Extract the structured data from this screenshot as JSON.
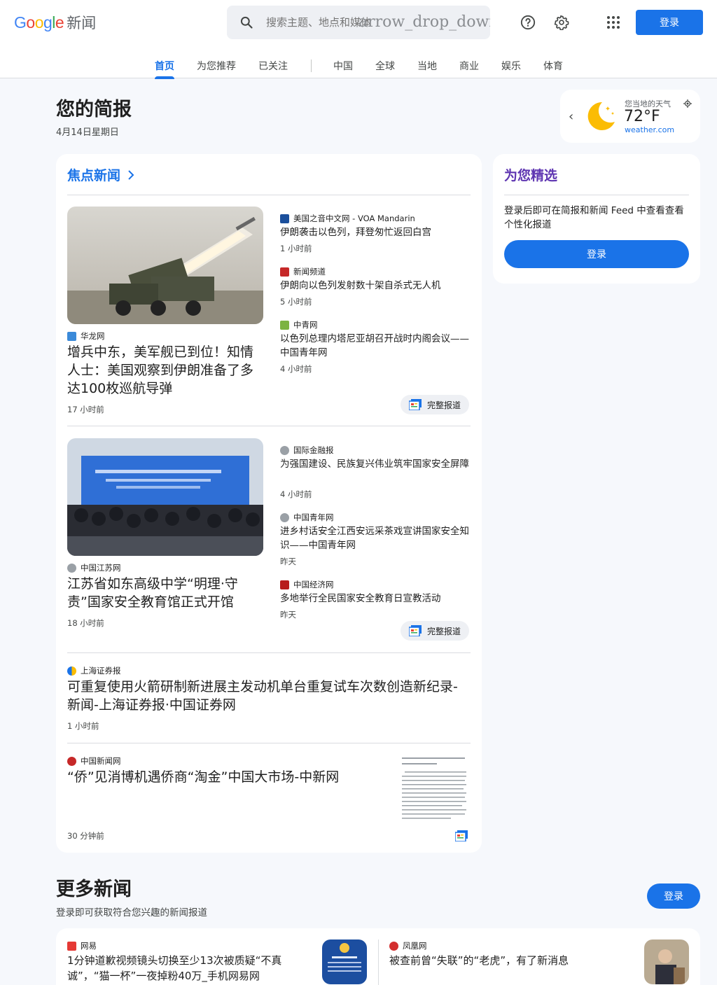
{
  "header": {
    "logo_word": "Google",
    "logo_news": "新闻",
    "search_placeholder": "搜索主题、地点和媒体",
    "search_ligature": "arrow_drop_down",
    "login_label": "登录",
    "icons": [
      "search-icon",
      "help-icon",
      "gear-icon",
      "apps-icon"
    ]
  },
  "nav": {
    "tabs": [
      {
        "label": "首页",
        "active": true
      },
      {
        "label": "为您推荐"
      },
      {
        "label": "已关注"
      },
      {
        "label": "中国"
      },
      {
        "label": "全球"
      },
      {
        "label": "当地"
      },
      {
        "label": "商业"
      },
      {
        "label": "娱乐"
      },
      {
        "label": "体育"
      }
    ]
  },
  "briefing": {
    "title": "您的简报",
    "date": "4月14日星期日"
  },
  "weather": {
    "label": "您当地的天气",
    "temp": "72°F",
    "source": "weather.com"
  },
  "focus": {
    "title": "焦点新闻",
    "full_coverage": "完整报道",
    "cluster1": {
      "main": {
        "source": "华龙网",
        "headline": "增兵中东，美军舰已到位！知情人士：美国观察到伊朗准备了多达100枚巡航导弹",
        "time": "17 小时前"
      },
      "side": [
        {
          "source": "美国之音中文网 - VOA Mandarin",
          "headline": "伊朗袭击以色列，拜登匆忙返回白宫",
          "time": "1 小时前"
        },
        {
          "source": "新闻频道",
          "headline": "伊朗向以色列发射数十架自杀式无人机",
          "time": "5 小时前"
        },
        {
          "source": "中青网",
          "headline": "以色列总理内塔尼亚胡召开战时内阁会议——中国青年网",
          "time": "4 小时前"
        }
      ]
    },
    "cluster2": {
      "main": {
        "source": "中国江苏网",
        "headline": "江苏省如东高级中学“明理·守责”国家安全教育馆正式开馆",
        "time": "18 小时前"
      },
      "side": [
        {
          "source": "国际金融报",
          "headline": "为强国建设、民族复兴伟业筑牢国家安全屏障",
          "time": "4 小时前"
        },
        {
          "source": "中国青年网",
          "headline": "进乡村话安全江西安远采茶戏宣讲国家安全知识——中国青年网",
          "time": "昨天"
        },
        {
          "source": "中国经济网",
          "headline": "多地举行全民国家安全教育日宣教活动",
          "time": "昨天"
        }
      ]
    },
    "story3": {
      "source": "上海证券报",
      "headline": "可重复使用火箭研制新进展主发动机单台重复试车次数创造新纪录-新闻-上海证券报·中国证券网",
      "time": "1 小时前"
    },
    "story4": {
      "source": "中国新闻网",
      "headline": "“侨”见消博机遇侨商“淘金”中国大市场-中新网",
      "time": "30 分钟前"
    }
  },
  "picks": {
    "title": "为您精选",
    "text": "登录后即可在简报和新闻 Feed 中查看查看个性化报道",
    "button": "登录"
  },
  "more": {
    "title": "更多新闻",
    "subtitle": "登录即可获取符合您兴趣的新闻报道",
    "button": "登录",
    "items": [
      {
        "source": "网易",
        "headline": "1分钟道歉视频镜头切换至少13次被质疑“不真诚”，“猫一杯”一夜掉粉40万_手机网易网"
      },
      {
        "source": "凤凰网",
        "headline": "被查前曾“失联”的“老虎”，有了新消息"
      }
    ]
  },
  "colors": {
    "accent": "#1a73e8",
    "picks_title": "#5e35b1",
    "background": "#f6f8fc"
  }
}
